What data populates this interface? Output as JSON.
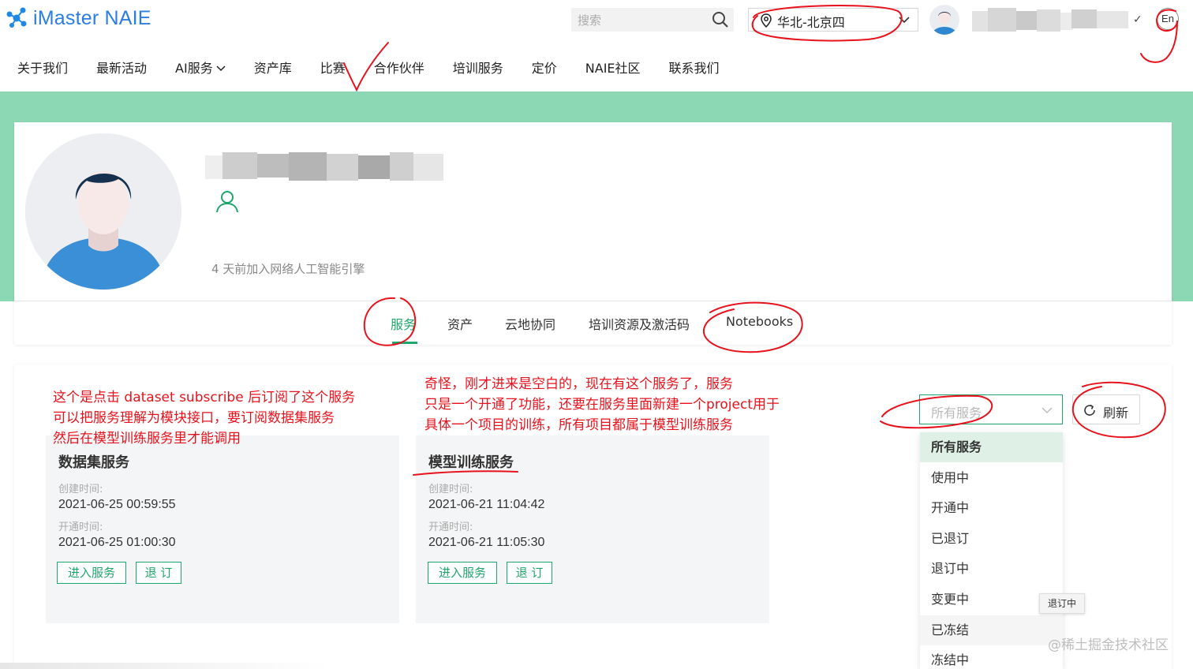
{
  "header": {
    "logo_text": "iMaster NAIE",
    "search_placeholder": "搜索",
    "region": "华北-北京四",
    "user_menu_chevron": "✓",
    "lang": "En"
  },
  "nav": {
    "items": [
      {
        "label": "关于我们"
      },
      {
        "label": "最新活动"
      },
      {
        "label": "AI服务",
        "has_dropdown": true
      },
      {
        "label": "资产库"
      },
      {
        "label": "比赛"
      },
      {
        "label": "合作伙伴"
      },
      {
        "label": "培训服务"
      },
      {
        "label": "定价"
      },
      {
        "label": "NAIE社区"
      },
      {
        "label": "联系我们"
      }
    ]
  },
  "profile": {
    "joined": "4 天前加入网络人工智能引擎"
  },
  "tabs": [
    {
      "label": "服务",
      "active": true
    },
    {
      "label": "资产"
    },
    {
      "label": "云地协同"
    },
    {
      "label": "培训资源及激活码"
    },
    {
      "label": "Notebooks"
    }
  ],
  "services": {
    "filter_placeholder": "所有服务",
    "refresh_label": "刷新",
    "cards": [
      {
        "title": "数据集服务",
        "created_label": "创建时间:",
        "created_value": "2021-06-25 00:59:55",
        "opened_label": "开通时间:",
        "opened_value": "2021-06-25 01:00:30",
        "enter_label": "进入服务",
        "unsubscribe_label": "退 订"
      },
      {
        "title": "模型训练服务",
        "created_label": "创建时间:",
        "created_value": "2021-06-21 11:04:42",
        "opened_label": "开通时间:",
        "opened_value": "2021-06-21 11:05:30",
        "enter_label": "进入服务",
        "unsubscribe_label": "退 订"
      }
    ],
    "dropdown_options": [
      {
        "label": "所有服务",
        "selected": true
      },
      {
        "label": "使用中"
      },
      {
        "label": "开通中"
      },
      {
        "label": "已退订"
      },
      {
        "label": "退订中"
      },
      {
        "label": "变更中"
      },
      {
        "label": "已冻结"
      },
      {
        "label": "冻结中"
      }
    ],
    "tooltip": "退订中"
  },
  "annotations": {
    "left": [
      "这个是点击 dataset subscribe 后订阅了这个服务",
      "可以把服务理解为模块接口，要订阅数据集服务",
      "然后在模型训练服务里才能调用"
    ],
    "right": [
      "奇怪，刚才进来是空白的，现在有这个服务了，服务",
      "只是一个开通了功能，还要在服务里面新建一个project用于",
      "具体一个项目的训练，所有项目都属于模型训练服务"
    ]
  },
  "watermark": "@稀土掘金技术社区",
  "colors": {
    "accent": "#1ea66c",
    "band": "#8dd8b4",
    "annotation": "#e8121c",
    "logo": "#2b7de0"
  }
}
